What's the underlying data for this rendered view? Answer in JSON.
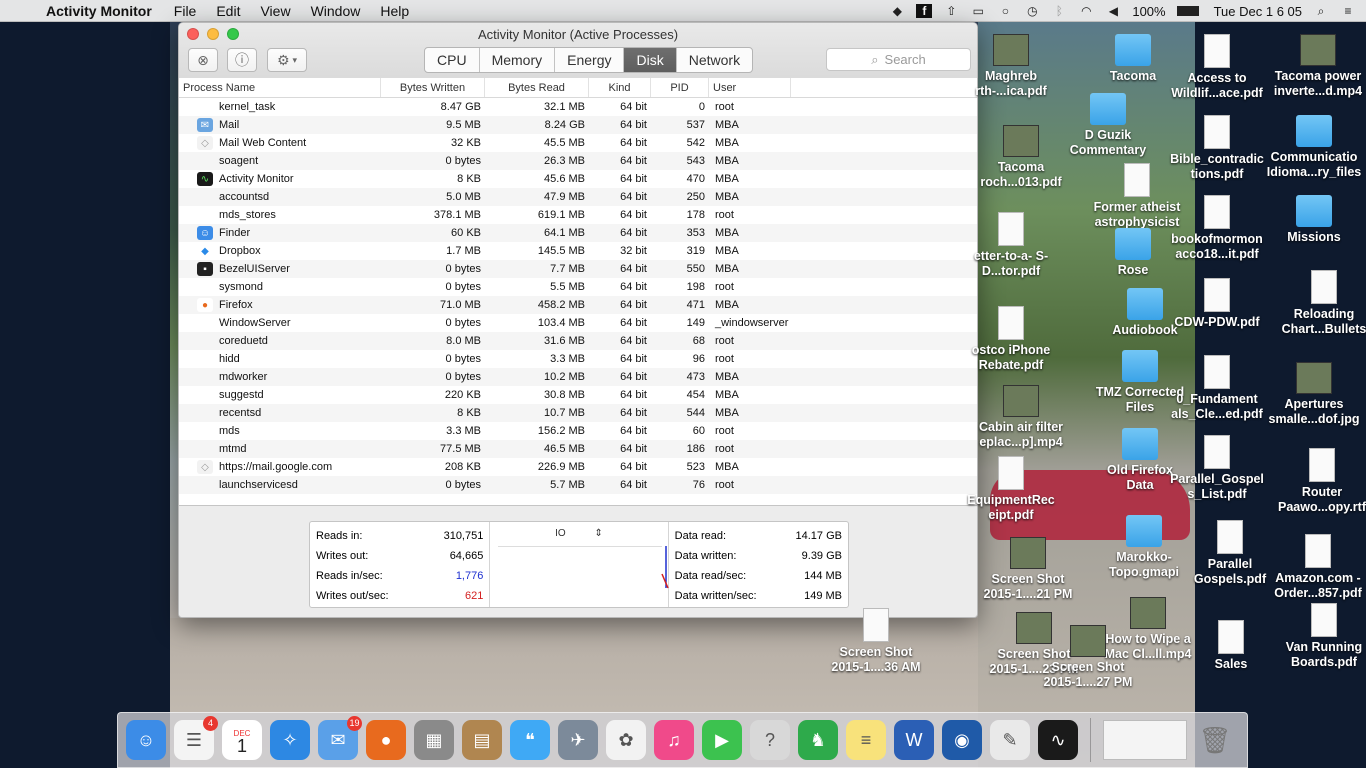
{
  "menubar": {
    "app_name": "Activity Monitor",
    "menus": [
      "File",
      "Edit",
      "View",
      "Window",
      "Help"
    ],
    "battery": "100%",
    "clock": "Tue Dec 1  6 05"
  },
  "window": {
    "title": "Activity Monitor (Active Processes)",
    "tabs": [
      "CPU",
      "Memory",
      "Energy",
      "Disk",
      "Network"
    ],
    "active_tab": "Disk",
    "search_placeholder": "Search"
  },
  "table": {
    "columns": [
      "Process Name",
      "Bytes Written",
      "Bytes Read",
      "Kind",
      "PID",
      "User"
    ],
    "rows": [
      {
        "icon": "",
        "name": "kernel_task",
        "bw": "8.47 GB",
        "br": "32.1 MB",
        "kind": "64 bit",
        "pid": "0",
        "user": "root"
      },
      {
        "icon": "mail-icon",
        "name": "Mail",
        "bw": "9.5 MB",
        "br": "8.24 GB",
        "kind": "64 bit",
        "pid": "537",
        "user": "MBA"
      },
      {
        "icon": "shield-icon",
        "name": "Mail Web Content",
        "bw": "32 KB",
        "br": "45.5 MB",
        "kind": "64 bit",
        "pid": "542",
        "user": "MBA"
      },
      {
        "icon": "",
        "name": "soagent",
        "bw": "0 bytes",
        "br": "26.3 MB",
        "kind": "64 bit",
        "pid": "543",
        "user": "MBA"
      },
      {
        "icon": "activity-monitor-icon",
        "name": "Activity Monitor",
        "bw": "8 KB",
        "br": "45.6 MB",
        "kind": "64 bit",
        "pid": "470",
        "user": "MBA"
      },
      {
        "icon": "",
        "name": "accountsd",
        "bw": "5.0 MB",
        "br": "47.9 MB",
        "kind": "64 bit",
        "pid": "250",
        "user": "MBA"
      },
      {
        "icon": "",
        "name": "mds_stores",
        "bw": "378.1 MB",
        "br": "619.1 MB",
        "kind": "64 bit",
        "pid": "178",
        "user": "root"
      },
      {
        "icon": "finder-icon",
        "name": "Finder",
        "bw": "60 KB",
        "br": "64.1 MB",
        "kind": "64 bit",
        "pid": "353",
        "user": "MBA"
      },
      {
        "icon": "dropbox-icon",
        "name": "Dropbox",
        "bw": "1.7 MB",
        "br": "145.5 MB",
        "kind": "32 bit",
        "pid": "319",
        "user": "MBA"
      },
      {
        "icon": "terminal-icon",
        "name": "BezelUIServer",
        "bw": "0 bytes",
        "br": "7.7 MB",
        "kind": "64 bit",
        "pid": "550",
        "user": "MBA"
      },
      {
        "icon": "",
        "name": "sysmond",
        "bw": "0 bytes",
        "br": "5.5 MB",
        "kind": "64 bit",
        "pid": "198",
        "user": "root"
      },
      {
        "icon": "firefox-icon",
        "name": "Firefox",
        "bw": "71.0 MB",
        "br": "458.2 MB",
        "kind": "64 bit",
        "pid": "471",
        "user": "MBA"
      },
      {
        "icon": "",
        "name": "WindowServer",
        "bw": "0 bytes",
        "br": "103.4 MB",
        "kind": "64 bit",
        "pid": "149",
        "user": "_windowserver"
      },
      {
        "icon": "",
        "name": "coreduetd",
        "bw": "8.0 MB",
        "br": "31.6 MB",
        "kind": "64 bit",
        "pid": "68",
        "user": "root"
      },
      {
        "icon": "",
        "name": "hidd",
        "bw": "0 bytes",
        "br": "3.3 MB",
        "kind": "64 bit",
        "pid": "96",
        "user": "root"
      },
      {
        "icon": "",
        "name": "mdworker",
        "bw": "0 bytes",
        "br": "10.2 MB",
        "kind": "64 bit",
        "pid": "473",
        "user": "MBA"
      },
      {
        "icon": "",
        "name": "suggestd",
        "bw": "220 KB",
        "br": "30.8 MB",
        "kind": "64 bit",
        "pid": "454",
        "user": "MBA"
      },
      {
        "icon": "",
        "name": "recentsd",
        "bw": "8 KB",
        "br": "10.7 MB",
        "kind": "64 bit",
        "pid": "544",
        "user": "MBA"
      },
      {
        "icon": "",
        "name": "mds",
        "bw": "3.3 MB",
        "br": "156.2 MB",
        "kind": "64 bit",
        "pid": "60",
        "user": "root"
      },
      {
        "icon": "",
        "name": "mtmd",
        "bw": "77.5 MB",
        "br": "46.5 MB",
        "kind": "64 bit",
        "pid": "186",
        "user": "root"
      },
      {
        "icon": "shield-icon",
        "name": "https://mail.google.com",
        "bw": "208 KB",
        "br": "226.9 MB",
        "kind": "64 bit",
        "pid": "523",
        "user": "MBA"
      },
      {
        "icon": "",
        "name": "launchservicesd",
        "bw": "0 bytes",
        "br": "5.7 MB",
        "kind": "64 bit",
        "pid": "76",
        "user": "root"
      }
    ]
  },
  "stats": {
    "left": [
      {
        "label": "Reads in:",
        "value": "310,751",
        "color": ""
      },
      {
        "label": "Writes out:",
        "value": "64,665",
        "color": ""
      },
      {
        "label": "Reads in/sec:",
        "value": "1,776",
        "color": "blue"
      },
      {
        "label": "Writes out/sec:",
        "value": "621",
        "color": "red"
      }
    ],
    "graph_label": "IO",
    "right": [
      {
        "label": "Data read:",
        "value": "14.17 GB"
      },
      {
        "label": "Data written:",
        "value": "9.39 GB"
      },
      {
        "label": "Data read/sec:",
        "value": "144 MB"
      },
      {
        "label": "Data written/sec:",
        "value": "149 MB"
      }
    ]
  },
  "desktop": {
    "icons": [
      {
        "label": "Maghreb rth-...ica.pdf",
        "kind": "thumb"
      },
      {
        "label": "Tacoma",
        "kind": "folder"
      },
      {
        "label": "Access to Wildlif...ace.pdf",
        "kind": "doc"
      },
      {
        "label": "Tacoma power inverte...d.mp4",
        "kind": "thumb"
      },
      {
        "label": "D Guzik Commentary",
        "kind": "folder"
      },
      {
        "label": "Tacoma roch...013.pdf",
        "kind": "thumb"
      },
      {
        "label": "Bible_contradic tions.pdf",
        "kind": "doc"
      },
      {
        "label": "Communicatio Idioma...ry_files",
        "kind": "folder"
      },
      {
        "label": "Former atheist astrophysicist",
        "kind": "doc"
      },
      {
        "label": "etter-to-a- S-D...tor.pdf",
        "kind": "doc"
      },
      {
        "label": "bookofmormon acco18...it.pdf",
        "kind": "doc"
      },
      {
        "label": "Missions",
        "kind": "folder"
      },
      {
        "label": "Rose",
        "kind": "folder"
      },
      {
        "label": "Audiobook",
        "kind": "folder"
      },
      {
        "label": "CDW-PDW.pdf",
        "kind": "doc"
      },
      {
        "label": "Reloading Chart...Bullets",
        "kind": "doc"
      },
      {
        "label": "ostco iPhone Rebate.pdf",
        "kind": "doc"
      },
      {
        "label": "TMZ Corrected Files",
        "kind": "folder"
      },
      {
        "label": "0_Fundament als_Cle...ed.pdf",
        "kind": "doc"
      },
      {
        "label": "Apertures smalle...dof.jpg",
        "kind": "thumb"
      },
      {
        "label": "Cabin air filter eplac...p].mp4",
        "kind": "thumb"
      },
      {
        "label": "Old Firefox Data",
        "kind": "folder"
      },
      {
        "label": "Parallel_Gospel s_List.pdf",
        "kind": "doc"
      },
      {
        "label": "Router Paawo...opy.rtf",
        "kind": "doc"
      },
      {
        "label": "EquipmentRec eipt.pdf",
        "kind": "doc"
      },
      {
        "label": "Marokko- Topo.gmapi",
        "kind": "folder"
      },
      {
        "label": "Parallel Gospels.pdf",
        "kind": "doc"
      },
      {
        "label": "Amazon.com - Order...857.pdf",
        "kind": "doc"
      },
      {
        "label": "Screen Shot 2015-1....21 PM",
        "kind": "thumb"
      },
      {
        "label": "How to Wipe a Mac Cl...ll.mp4",
        "kind": "thumb"
      },
      {
        "label": "Sales",
        "kind": "doc"
      },
      {
        "label": "Van Running Boards.pdf",
        "kind": "doc"
      },
      {
        "label": "Screen Shot 2015-1....36 AM",
        "kind": "doc"
      },
      {
        "label": "Screen Shot 2015-1....23 PM",
        "kind": "thumb"
      },
      {
        "label": "Screen Shot 2015-1....27 PM",
        "kind": "thumb"
      }
    ]
  },
  "dock": {
    "items": [
      {
        "name": "finder",
        "color": "#3c8ce7",
        "badge": ""
      },
      {
        "name": "reminders",
        "color": "#f4f4f4",
        "badge": "4"
      },
      {
        "name": "calendar",
        "color": "#ffffff",
        "badge": ""
      },
      {
        "name": "safari",
        "color": "#2d88e3",
        "badge": ""
      },
      {
        "name": "mail-app",
        "color": "#5aa0e8",
        "badge": "19"
      },
      {
        "name": "firefox",
        "color": "#e86a1e",
        "badge": ""
      },
      {
        "name": "calculator",
        "color": "#8a8a8a",
        "badge": ""
      },
      {
        "name": "contacts",
        "color": "#b08650",
        "badge": ""
      },
      {
        "name": "messages",
        "color": "#3fa9f5",
        "badge": ""
      },
      {
        "name": "launchpad",
        "color": "#7c8a9a",
        "badge": ""
      },
      {
        "name": "photos",
        "color": "#f2f2f2",
        "badge": ""
      },
      {
        "name": "itunes",
        "color": "#f04a8a",
        "badge": ""
      },
      {
        "name": "facetime",
        "color": "#3cc24f",
        "badge": ""
      },
      {
        "name": "help",
        "color": "#d8d8d8",
        "badge": ""
      },
      {
        "name": "evernote",
        "color": "#2eaa4b",
        "badge": ""
      },
      {
        "name": "notes",
        "color": "#f8e27b",
        "badge": ""
      },
      {
        "name": "word",
        "color": "#2b5fb5",
        "badge": ""
      },
      {
        "name": "remote-support",
        "color": "#1f5aa8",
        "badge": ""
      },
      {
        "name": "textedit",
        "color": "#e9e9e9",
        "badge": ""
      },
      {
        "name": "activity-monitor",
        "color": "#1a1a1a",
        "badge": ""
      }
    ],
    "calendar_month": "DEC",
    "calendar_day": "1"
  }
}
